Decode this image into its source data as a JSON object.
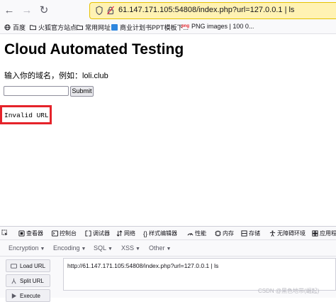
{
  "browser": {
    "url": "61.147.171.105:54808/index.php?url=127.0.0.1 | ls"
  },
  "bookmarks": [
    {
      "label": "百度",
      "icon": "globe-icon"
    },
    {
      "label": "火狐官方站点",
      "icon": "folder-icon"
    },
    {
      "label": "常用网址",
      "icon": "folder-icon"
    },
    {
      "label": "商业计划书PPT模板下...",
      "icon": "ppt-icon"
    },
    {
      "label": "PNG images | 100 0...",
      "icon": "png-icon"
    }
  ],
  "page": {
    "title": "Cloud Automated Testing",
    "prompt": "输入你的域名，例如：loli.club",
    "input_value": "",
    "submit_label": "Submit",
    "result": "Invalid URL"
  },
  "devtools": {
    "tabs": [
      {
        "label": "查看器",
        "icon": "inspector-icon"
      },
      {
        "label": "控制台",
        "icon": "console-icon"
      },
      {
        "label": "调试器",
        "icon": "debugger-icon"
      },
      {
        "label": "网络",
        "icon": "network-icon"
      },
      {
        "label": "样式编辑器",
        "icon": "style-editor-icon"
      },
      {
        "label": "性能",
        "icon": "performance-icon"
      },
      {
        "label": "内存",
        "icon": "memory-icon"
      },
      {
        "label": "存储",
        "icon": "storage-icon"
      },
      {
        "label": "无障碍环境",
        "icon": "accessibility-icon"
      },
      {
        "label": "应用程",
        "icon": "application-icon"
      }
    ],
    "hackbar_menu": [
      "Encryption",
      "Encoding",
      "SQL",
      "XSS",
      "Other"
    ],
    "hackbar_buttons": [
      "Load URL",
      "Split URL",
      "Execute"
    ],
    "hackbar_url": "http://61.147.171.105:54808/index.php?url=127.0.0.1 | ls"
  },
  "watermark": "CSDN @黑色地带(崛起)",
  "colors": {
    "urlbar_bg": "#fff2b3",
    "highlight_border": "#e5232a"
  }
}
